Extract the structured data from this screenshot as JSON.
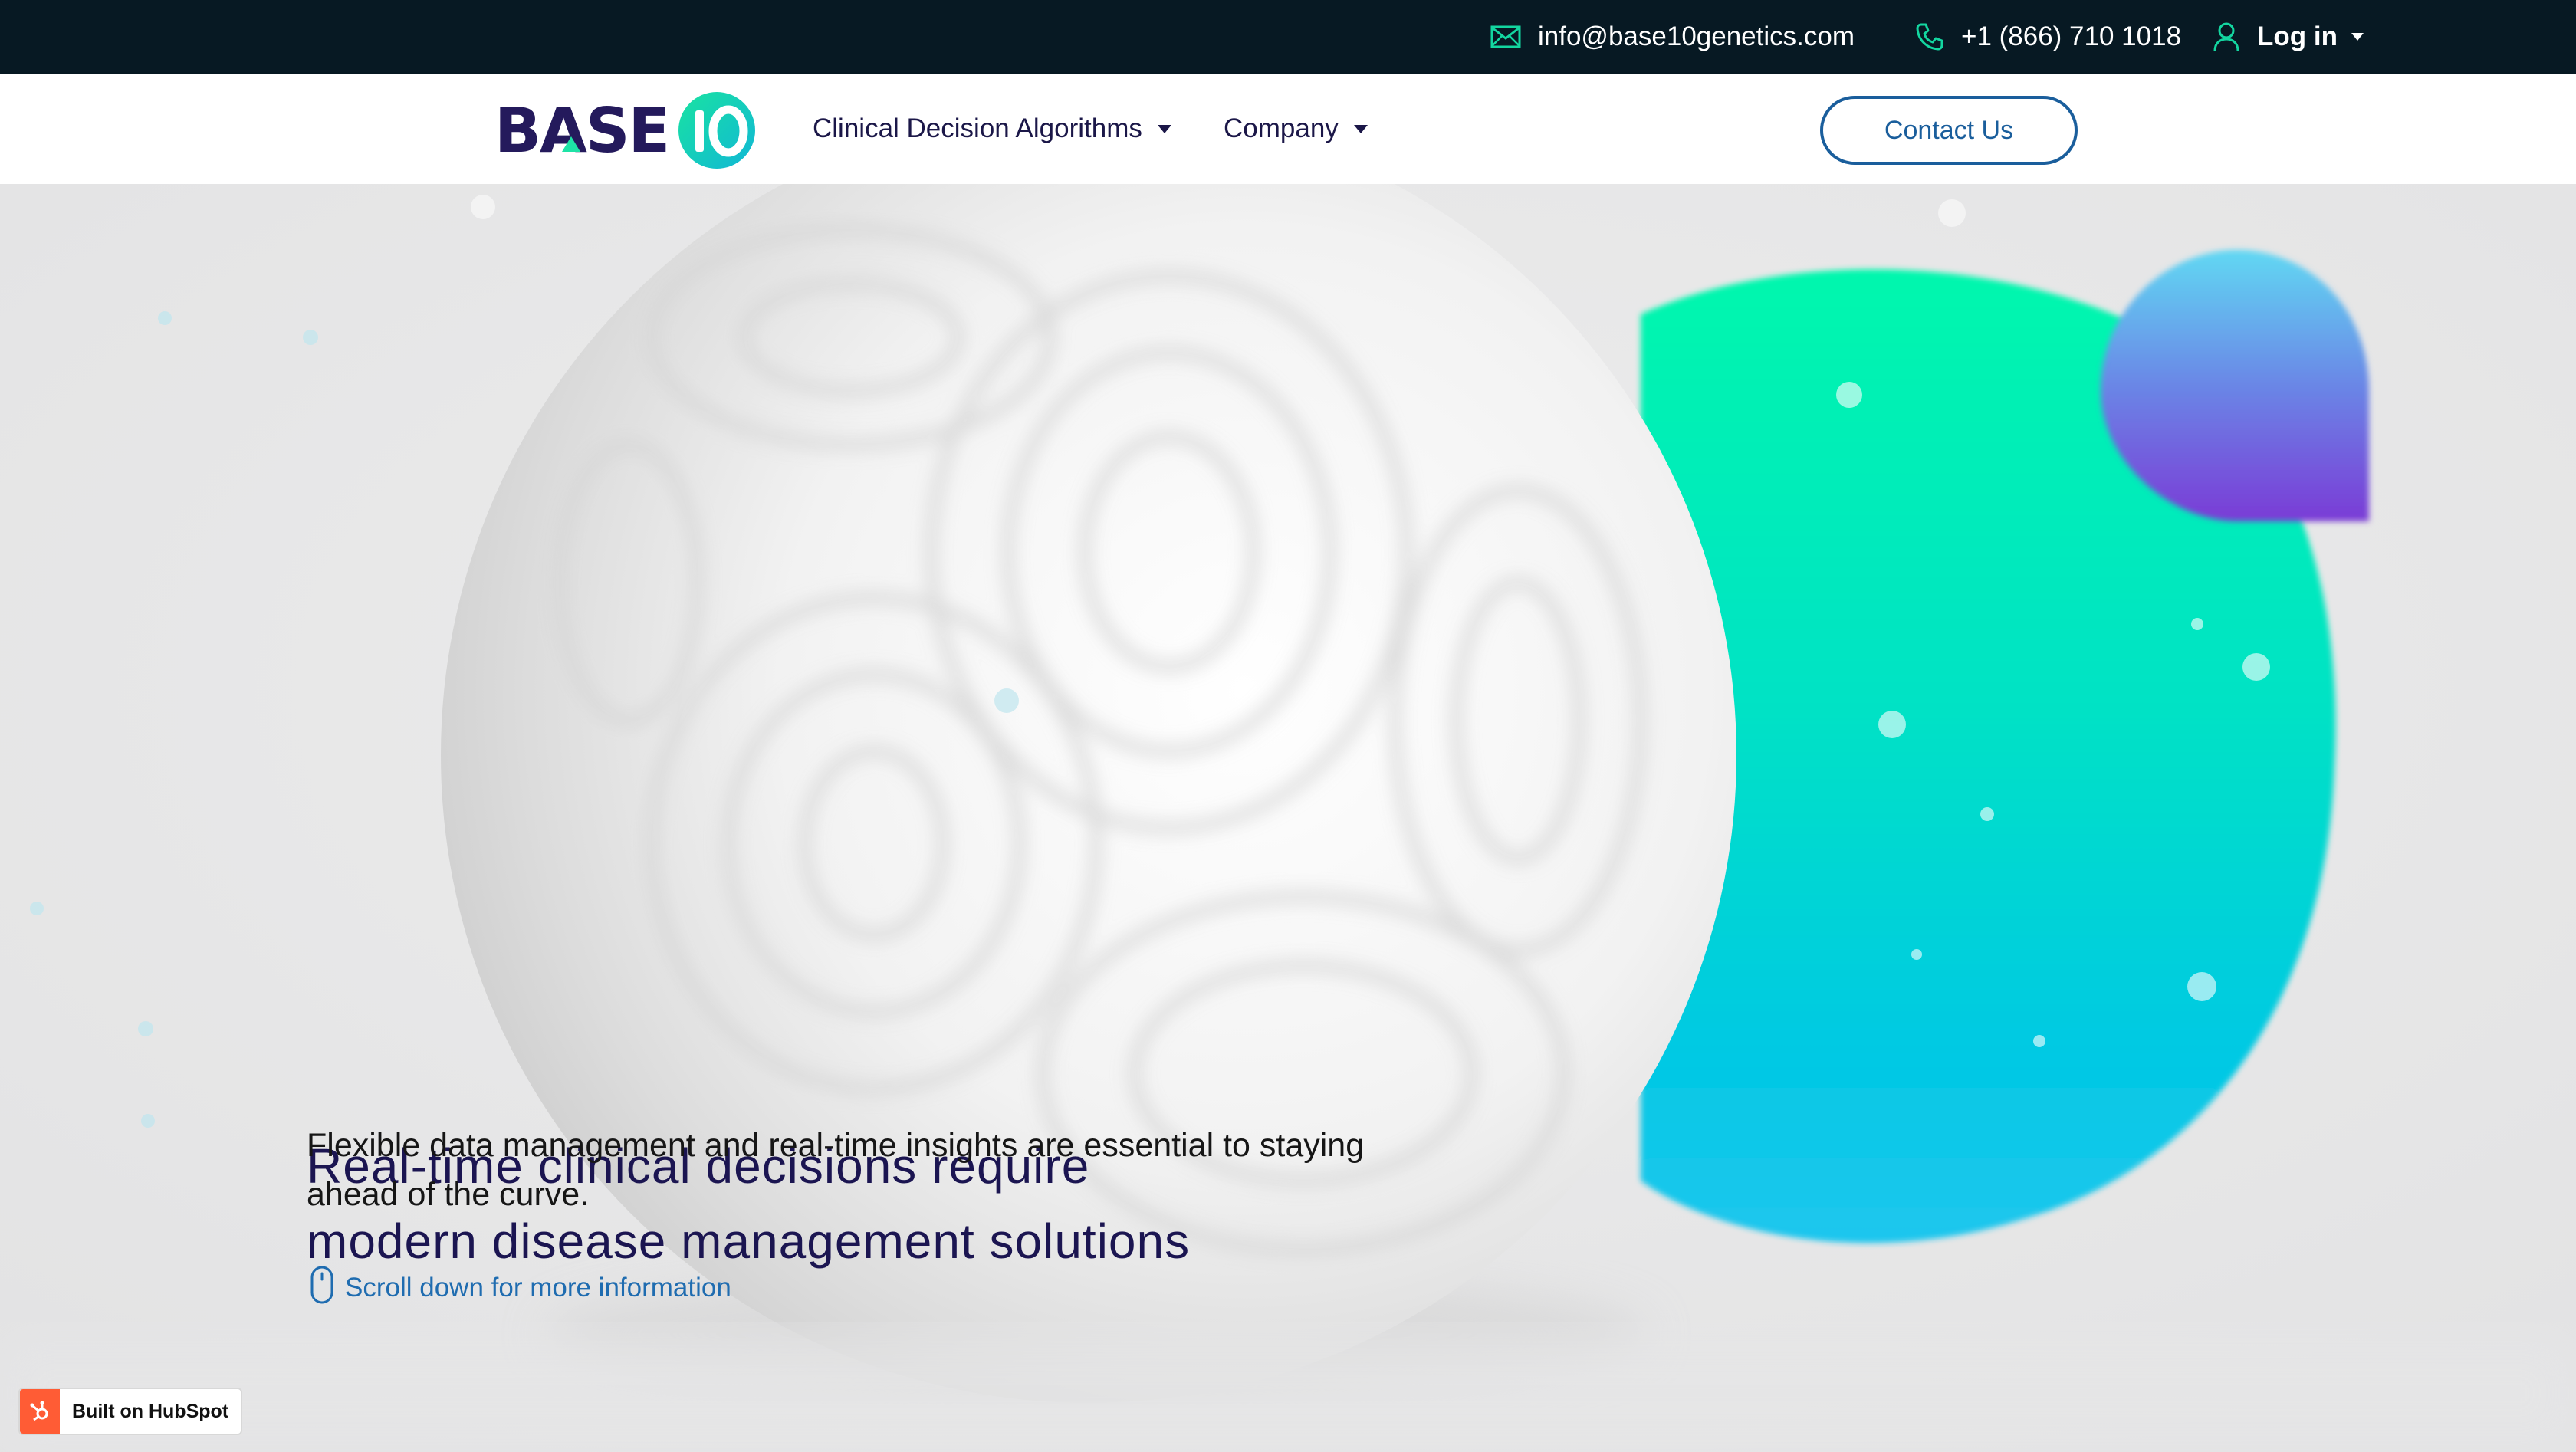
{
  "topbar": {
    "email": "info@base10genetics.com",
    "phone": "+1 (866) 710 1018",
    "login_label": "Log in"
  },
  "nav": {
    "logo_text": "BASE10",
    "items": [
      {
        "label": "Clinical Decision Algorithms"
      },
      {
        "label": "Company"
      }
    ],
    "contact_label": "Contact Us"
  },
  "hero": {
    "headline_line1": "Real-time clinical decisions require",
    "headline_line2": "modern disease management solutions",
    "subtext_line1": "Flexible data management and real-time insights are essential to staying",
    "subtext_line2": "ahead of the curve.",
    "scroll_label": "Scroll down for more information"
  },
  "badge": {
    "label": "Built on HubSpot"
  },
  "colors": {
    "topbar_bg": "#071923",
    "navy": "#1b1551",
    "link_blue": "#1a5e9c",
    "accent_green": "#00f5a8",
    "accent_cyan": "#00c8e6",
    "accent_purple": "#7b39d8",
    "hubspot_orange": "#ff5c35"
  },
  "icons": [
    "mail-icon",
    "phone-icon",
    "user-icon",
    "caret-down-icon",
    "mouse-icon",
    "hubspot-sprocket-icon"
  ]
}
